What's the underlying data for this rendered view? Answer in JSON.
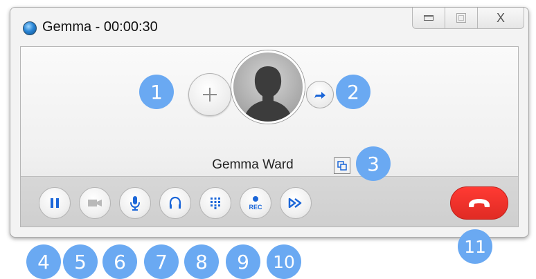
{
  "window": {
    "title": "Gemma - 00:00:30",
    "controls": {
      "minimize_icon": "minimize-icon",
      "maximize_icon": "maximize-icon",
      "close_label": "X"
    }
  },
  "call": {
    "contact_name": "Gemma Ward",
    "add_participant_icon": "plus-icon",
    "avatar_icon": "person-silhouette-icon",
    "forward_icon": "forward-arrow-icon",
    "copy_icon": "copy-icon"
  },
  "toolbar": {
    "buttons": [
      {
        "name": "hold-button",
        "icon": "pause-icon"
      },
      {
        "name": "video-button",
        "icon": "video-camera-icon"
      },
      {
        "name": "mute-button",
        "icon": "microphone-icon"
      },
      {
        "name": "audio-device-button",
        "icon": "headset-icon"
      },
      {
        "name": "dialpad-button",
        "icon": "keypad-icon"
      },
      {
        "name": "record-button",
        "icon": "record-icon",
        "label": "REC"
      },
      {
        "name": "transfer-button",
        "icon": "fast-forward-icon"
      }
    ],
    "hangup_icon": "hangup-phone-icon"
  },
  "badges": [
    "1",
    "2",
    "3",
    "4",
    "5",
    "6",
    "7",
    "8",
    "9",
    "10",
    "11"
  ],
  "colors": {
    "accent_blue": "#1b66d8",
    "badge_blue": "#6aa9f2",
    "hangup_red": "#e8302a"
  }
}
